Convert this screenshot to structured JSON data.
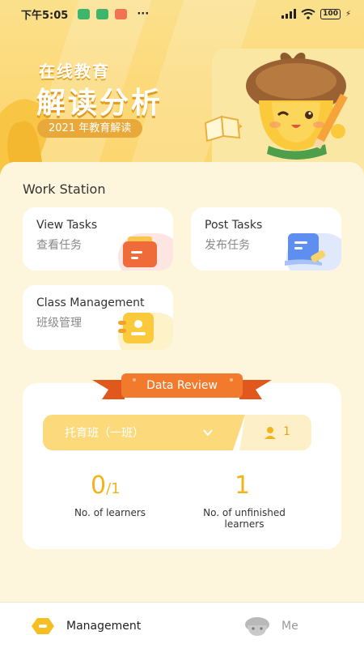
{
  "status_bar": {
    "time": "下午5:05",
    "dots": "···",
    "battery": "100",
    "bolt": "⚡"
  },
  "banner": {
    "subtitle": "在线教育",
    "title": "解读分析",
    "pill": "2021 年教育解读"
  },
  "workstation": {
    "title": "Work Station",
    "cards": [
      {
        "en": "View Tasks",
        "zh": "查看任务"
      },
      {
        "en": "Post Tasks",
        "zh": "发布任务"
      },
      {
        "en": "Class Management",
        "zh": "班级管理"
      }
    ]
  },
  "review": {
    "title": "Data Review",
    "class_name": "托育班（一班）",
    "class_count": "1",
    "learners_value": "0",
    "learners_total": "/1",
    "learners_label": "No. of learners",
    "unfinished_value": "1",
    "unfinished_label": "No. of unfinished learners"
  },
  "tabs": [
    {
      "label": "Management",
      "icon": "hexagon-icon",
      "active": true
    },
    {
      "label": "Me",
      "icon": "mascot-face-icon",
      "active": false
    }
  ],
  "colors": {
    "accent": "#f1b41c",
    "ribbon": "#f0722a",
    "banner": "#fcd874"
  }
}
